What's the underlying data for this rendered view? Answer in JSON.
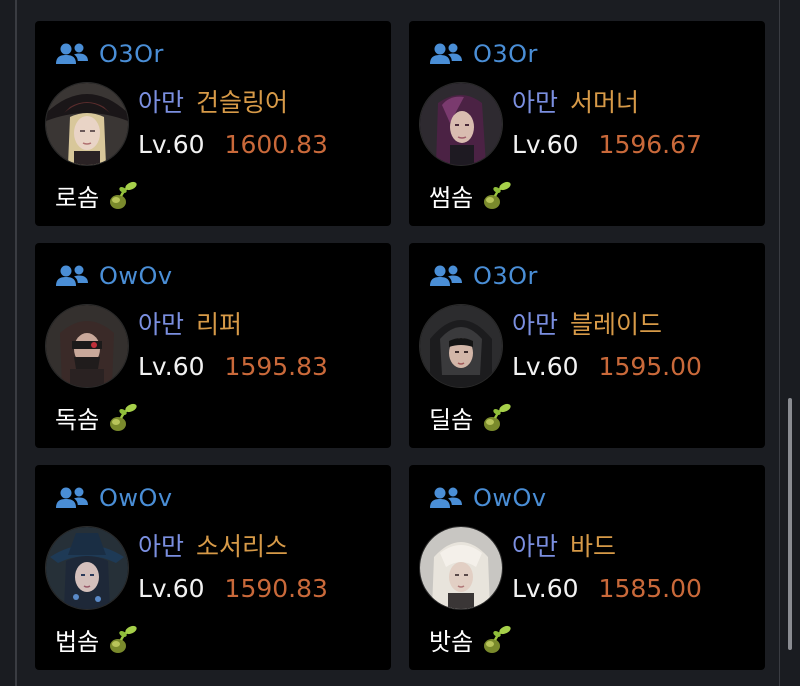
{
  "cards": [
    {
      "guild": "O3Or",
      "server": "아만",
      "class": "건슬링어",
      "level": "Lv.60",
      "score": "1600.83",
      "tag": "로솜",
      "avatar": "hat-blonde"
    },
    {
      "guild": "O3Or",
      "server": "아만",
      "class": "서머너",
      "level": "Lv.60",
      "score": "1596.67",
      "tag": "썸솜",
      "avatar": "purple-hair"
    },
    {
      "guild": "OwOv",
      "server": "아만",
      "class": "리퍼",
      "level": "Lv.60",
      "score": "1595.83",
      "tag": "독솜",
      "avatar": "masked"
    },
    {
      "guild": "O3Or",
      "server": "아만",
      "class": "블레이드",
      "level": "Lv.60",
      "score": "1595.00",
      "tag": "딜솜",
      "avatar": "hooded"
    },
    {
      "guild": "OwOv",
      "server": "아만",
      "class": "소서리스",
      "level": "Lv.60",
      "score": "1590.83",
      "tag": "법솜",
      "avatar": "witch-hat"
    },
    {
      "guild": "OwOv",
      "server": "아만",
      "class": "바드",
      "level": "Lv.60",
      "score": "1585.00",
      "tag": "밧솜",
      "avatar": "white-hair"
    }
  ],
  "icons": {
    "guild": "people-group-icon",
    "tag": "sprout-icon"
  },
  "colors": {
    "guild": "#4a8ed6",
    "server": "#7b8fe0",
    "class": "#d79a48",
    "score": "#c9693a",
    "card_bg": "#000000",
    "page_bg": "#1b1d22"
  }
}
